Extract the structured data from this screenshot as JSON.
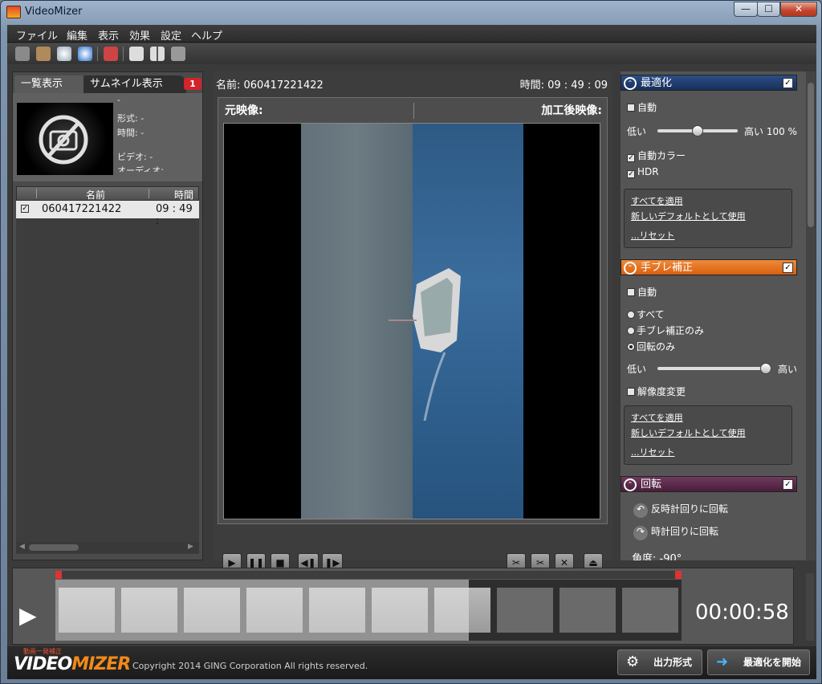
{
  "window": {
    "title": "VideoMizer",
    "min": "—",
    "max": "☐",
    "close": "✕"
  },
  "menu": [
    "ファイル",
    "編集",
    "表示",
    "効果",
    "設定",
    "ヘルプ"
  ],
  "left": {
    "tab_list": "一覧表示",
    "tab_thumb": "サムネイル表示",
    "badge": "1",
    "meta": {
      "name": "-",
      "format": "形式: -",
      "duration": "時間: -",
      "video": "ビデオ: -",
      "audio": "オーディオ:"
    },
    "list_headers": {
      "name": "名前",
      "time": "時間"
    },
    "row": {
      "name": "060417221422",
      "time": "09 : 49 :"
    }
  },
  "center": {
    "name": "名前: 060417221422",
    "time": "時間: 09 : 49 : 09",
    "orig_label": "元映像:",
    "proc_label": "加工後映像:"
  },
  "right": {
    "opt": {
      "title": "最適化",
      "auto": "自動",
      "low": "低い",
      "high": "高い 100 %",
      "auto_color": "自動カラー",
      "hdr": "HDR",
      "apply_all": "すべてを適用",
      "set_default": "新しいデフォルトとして使用",
      "reset": "...リセット",
      "level_percent": 100
    },
    "stab": {
      "title": "手ブレ補正",
      "auto": "自動",
      "all": "すべて",
      "shake_only": "手ブレ補正のみ",
      "rotate_only": "回転のみ",
      "low": "低い",
      "high": "高い",
      "res_change": "解像度変更",
      "apply_all": "すべてを適用",
      "set_default": "新しいデフォルトとして使用",
      "reset": "...リセット",
      "level_percent": 100
    },
    "rot": {
      "title": "回転",
      "ccw": "反時計回りに回転",
      "cw": "時計回りに回転",
      "angle": "角度: -90°"
    }
  },
  "timeline": {
    "time": "00:00:58",
    "played_fraction": 0.66
  },
  "footer": {
    "logo": "VIDEOMIZER",
    "logo_tag": "動画一発補正",
    "copyright": "Copyright 2014 GING Corporation All rights reserved.",
    "output_btn": "出力形式",
    "start_btn": "最適化を開始"
  },
  "colors": {
    "opt_head": "#1f3a66",
    "stab_head": "#e06d1a",
    "rot_head": "#5a2a4a",
    "badge": "#d2242a"
  },
  "icons": [
    "film-icon",
    "scissors-icon",
    "cd-icon",
    "disc-blue-icon",
    "delete-icon",
    "single-view-icon",
    "split-view-icon",
    "camera-icon",
    "play-icon",
    "pause-icon",
    "stop-icon",
    "prev-frame-icon",
    "next-frame-icon",
    "eject-icon",
    "gear-icon",
    "arrow-icon"
  ]
}
